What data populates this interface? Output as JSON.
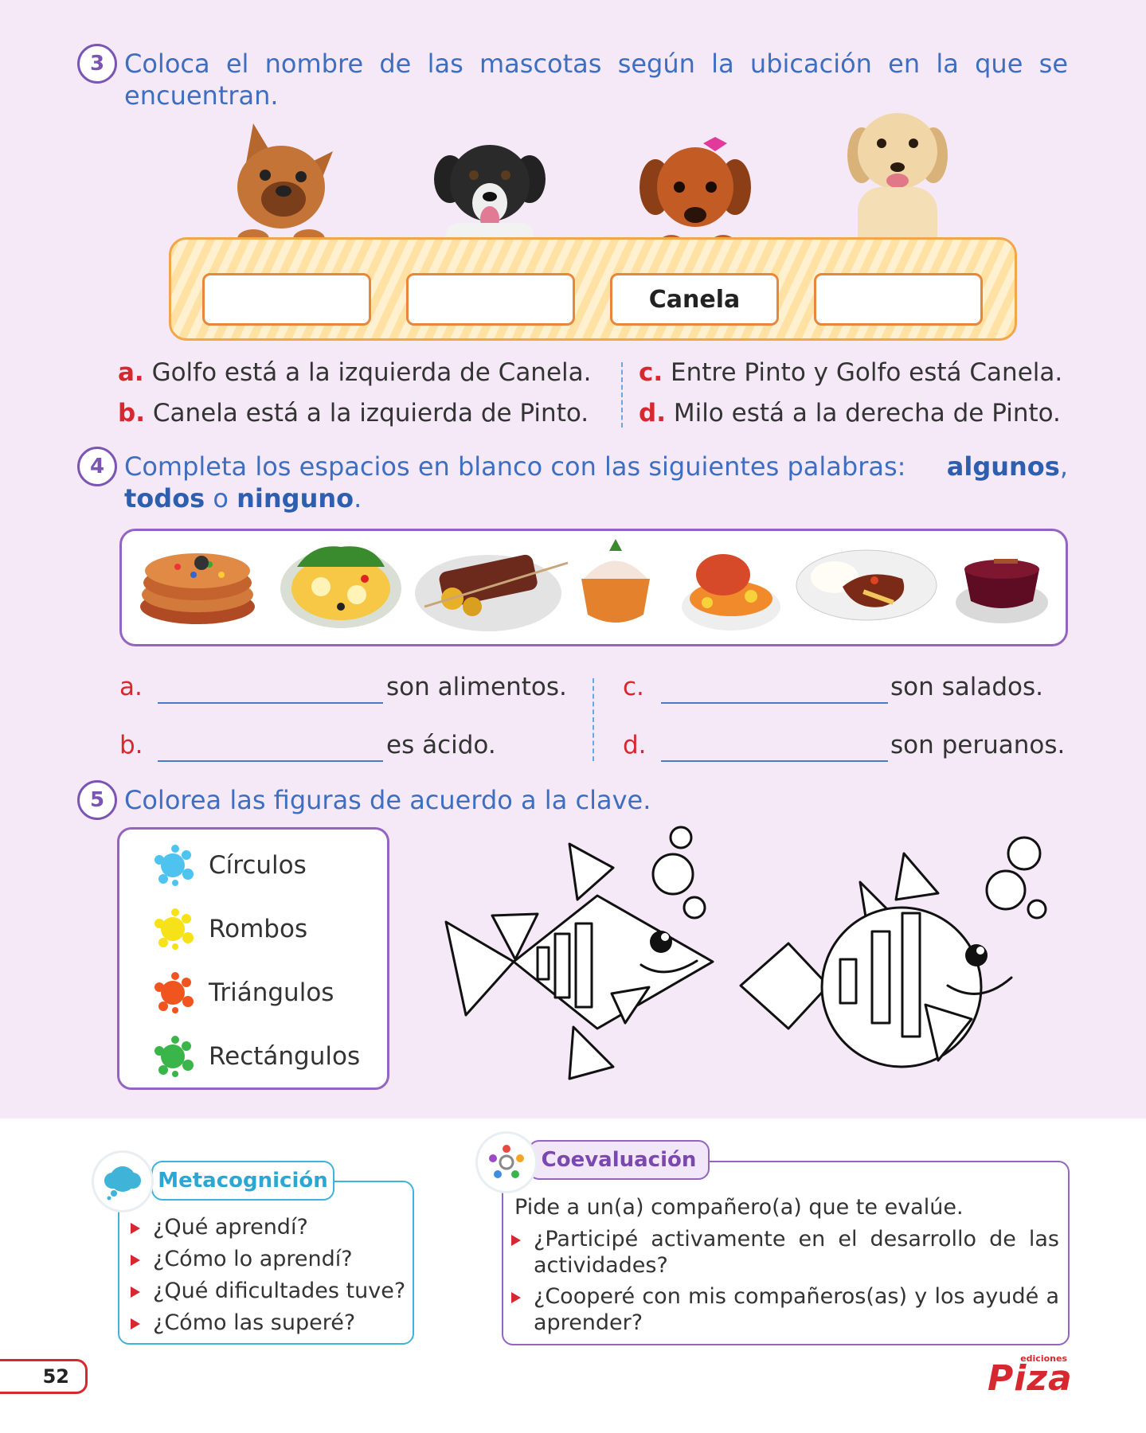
{
  "ex3": {
    "number": "3",
    "instruction": "Coloca el nombre de las mascotas según la ubicación en la que se encuentran.",
    "boxes": [
      "",
      "",
      "Canela",
      ""
    ],
    "clues": [
      {
        "letter": "a.",
        "text": "Golfo está a la izquierda de Canela."
      },
      {
        "letter": "b.",
        "text": "Canela está a la izquierda de Pinto."
      },
      {
        "letter": "c.",
        "text": "Entre Pinto y Golfo está Canela."
      },
      {
        "letter": "d.",
        "text": "Milo está a la derecha de Pinto."
      }
    ]
  },
  "ex4": {
    "number": "4",
    "instruction_lead": "Completa los espacios en blanco con las siguientes palabras:",
    "word1": "algunos",
    "word2": "todos",
    "connector": "o",
    "word3": "ninguno",
    "comma": ",",
    "period": ".",
    "rows": [
      {
        "letter": "a.",
        "suffix": "son alimentos."
      },
      {
        "letter": "b.",
        "suffix": "es ácido."
      },
      {
        "letter": "c.",
        "suffix": "son salados."
      },
      {
        "letter": "d.",
        "suffix": "son peruanos."
      }
    ]
  },
  "ex5": {
    "number": "5",
    "instruction": "Colorea las figuras de acuerdo a la clave.",
    "key": [
      {
        "label": "Círculos",
        "color": "#4fc3ef"
      },
      {
        "label": "Rombos",
        "color": "#f7e21a"
      },
      {
        "label": "Triángulos",
        "color": "#f0551f"
      },
      {
        "label": "Rectángulos",
        "color": "#39b54a"
      }
    ]
  },
  "meta": {
    "title": "Metacognición",
    "questions": [
      "¿Qué aprendí?",
      "¿Cómo lo aprendí?",
      "¿Qué dificultades tuve?",
      "¿Cómo las superé?"
    ]
  },
  "coev": {
    "title": "Coevaluación",
    "intro": "Pide a un(a) compañero(a) que te evalúe.",
    "q1": "¿Participé activamente en el desarrollo de las actividades?",
    "q2": "¿Cooperé con mis compañeros(as) y los ayudé a aprender?"
  },
  "footer": {
    "page_number": "52",
    "logo_small": "ediciones",
    "logo_main": "Piza"
  }
}
